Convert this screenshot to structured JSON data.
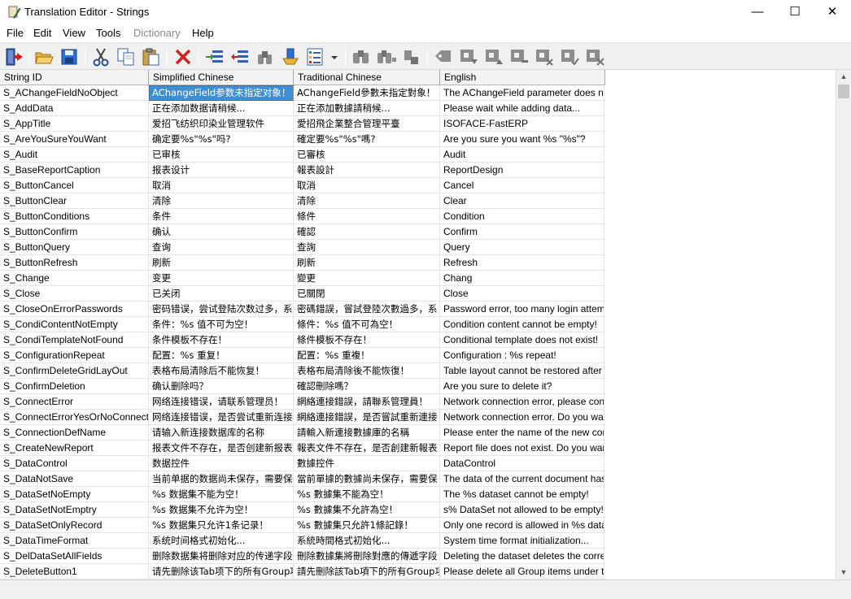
{
  "window": {
    "title": "Translation Editor - Strings",
    "minimize_glyph": "—",
    "maximize_glyph": "☐",
    "close_glyph": "✕"
  },
  "menu": [
    {
      "label": "File",
      "enabled": true
    },
    {
      "label": "Edit",
      "enabled": true
    },
    {
      "label": "View",
      "enabled": true
    },
    {
      "label": "Tools",
      "enabled": true
    },
    {
      "label": "Dictionary",
      "enabled": false
    },
    {
      "label": "Help",
      "enabled": true
    }
  ],
  "toolbar": {
    "icons": [
      "exit-icon",
      "open-icon",
      "save-icon",
      "cut-icon",
      "copy-icon",
      "paste-icon",
      "delete-icon",
      "insert-row-icon",
      "remove-row-icon",
      "find-icon",
      "sort-icon",
      "options-icon",
      "binoculars-icon",
      "binoculars-next-icon",
      "binoculars-prev-icon",
      "tag-icon",
      "tag-next-icon",
      "tag-prev-icon",
      "tag-remove-icon",
      "tag-x-icon",
      "tag-check-icon"
    ],
    "colors": {
      "accent_red": "#d42020",
      "accent_blue": "#2a6fd6",
      "accent_green": "#2f9a2f",
      "folder_yellow": "#e8b43a",
      "disabled_gray": "#8c8c8c"
    }
  },
  "grid": {
    "columns": [
      "String ID",
      "Simplified Chinese",
      "Traditional Chinese",
      "English"
    ],
    "selected_row": 0,
    "selected_col": 1,
    "selection_color": "#3f8fd6",
    "rows": [
      [
        "S_AChangeFieldNoObject",
        "AChangeField参数未指定对象！",
        "AChangeField參數未指定對象！",
        "The AChangeField parameter does not sp"
      ],
      [
        "S_AddData",
        "正在添加数据请稍候...",
        "正在添加數據請稍候...",
        "Please wait while adding data..."
      ],
      [
        "S_AppTitle",
        "爱招飞纺织印染业管理软件",
        "愛招飛企業整合管理平臺",
        "ISOFACE-FastERP"
      ],
      [
        "S_AreYouSureYouWant",
        "确定要%s\"%s\"吗?",
        "確定要%s\"%s\"嗎?",
        "Are you sure you want %s \"%s\"?"
      ],
      [
        "S_Audit",
        "已审核",
        "已審核",
        "Audit"
      ],
      [
        "S_BaseReportCaption",
        "报表设计",
        "報表設計",
        "ReportDesign"
      ],
      [
        "S_ButtonCancel",
        "取消",
        "取消",
        "Cancel"
      ],
      [
        "S_ButtonClear",
        "清除",
        "清除",
        "Clear"
      ],
      [
        "S_ButtonConditions",
        "条件",
        "條件",
        "Condition"
      ],
      [
        "S_ButtonConfirm",
        "确认",
        "確認",
        "Confirm"
      ],
      [
        "S_ButtonQuery",
        "查询",
        "查詢",
        "Query"
      ],
      [
        "S_ButtonRefresh",
        "刷新",
        "刷新",
        "Refresh"
      ],
      [
        "S_Change",
        "变更",
        "變更",
        "Chang"
      ],
      [
        "S_Close",
        "已关闭",
        "已關閉",
        "Close"
      ],
      [
        "S_CloseOnErrorPasswords",
        "密码错误，尝试登陆次数过多，系",
        "密碼錯誤，嘗試登陸次數過多，系",
        "Password error, too many login attempts,"
      ],
      [
        "S_CondiContentNotEmpty",
        "条件：%s 值不可为空！",
        "條件：%s 值不可為空！",
        "Condition content cannot be empty!"
      ],
      [
        "S_CondiTemplateNotFound",
        "条件模板不存在！",
        "條件模板不存在！",
        "Conditional template does not exist!"
      ],
      [
        "S_ConfigurationRepeat",
        "配置：%s 重复！",
        "配置：%s 重複！",
        "Configuration : %s  repeat!"
      ],
      [
        "S_ConfirmDeleteGridLayOut",
        "表格布局清除后不能恢复！",
        "表格布局清除後不能恢復！",
        "Table layout cannot be restored after clea"
      ],
      [
        "S_ConfirmDeletion",
        "确认删除吗？",
        "確認刪除嗎？",
        "Are you sure to delete it?"
      ],
      [
        "S_ConnectError",
        "网络连接错误，请联系管理员！",
        "網絡連接錯誤，請聯系管理員！",
        "Network connection error, please contact"
      ],
      [
        "S_ConnectErrorYesOrNoConnect",
        "网络连接错误，是否尝试重新连接",
        "網絡連接錯誤，是否嘗試重新連接",
        "Network connection error. Do you want to"
      ],
      [
        "S_ConnectionDefName",
        "请输入新连接数据库的名称",
        "請輸入新連接數據庫的名稱",
        "Please enter the name of the new connec"
      ],
      [
        "S_CreateNewReport",
        "报表文件不存在，是否创建新报表",
        "報表文件不存在，是否創建新報表",
        "Report file does not exist. Do you want to"
      ],
      [
        "S_DataControl",
        "数据控件",
        "數據控件",
        "DataControl"
      ],
      [
        "S_DataNotSave",
        "当前单据的数据尚未保存，需要保",
        "當前單據的數據尚未保存，需要保",
        "The data of the current document has no"
      ],
      [
        "S_DataSetNoEmpty",
        "%s 数据集不能为空！",
        "%s 數據集不能為空！",
        "The %s dataset cannot be empty!"
      ],
      [
        "S_DataSetNotEmptry",
        "%s 数据集不允许为空！",
        "%s 數據集不允許為空！",
        "s% DataSet not allowed to be empty!"
      ],
      [
        "S_DataSetOnlyRecord",
        "%s 数据集只允许1条记录！",
        "%s 數據集只允許1條記錄！",
        "Only one record is allowed in %s dataset!"
      ],
      [
        "S_DataTimeFormat",
        "系统时间格式初始化...",
        "系統時間格式初始化...",
        "System time format initialization..."
      ],
      [
        "S_DelDataSetAllFields",
        "删除数据集将删除对应的传递字段",
        "刪除數據集將刪除對應的傳遞字段",
        "Deleting the dataset deletes the correspo"
      ],
      [
        "S_DeleteButton1",
        "请先删除该Tab项下的所有Group项",
        "請先刪除該Tab項下的所有Group項",
        "Please delete all Group items under the Ta"
      ]
    ]
  },
  "scrollbar": {
    "up_glyph": "▲",
    "down_glyph": "▼"
  }
}
